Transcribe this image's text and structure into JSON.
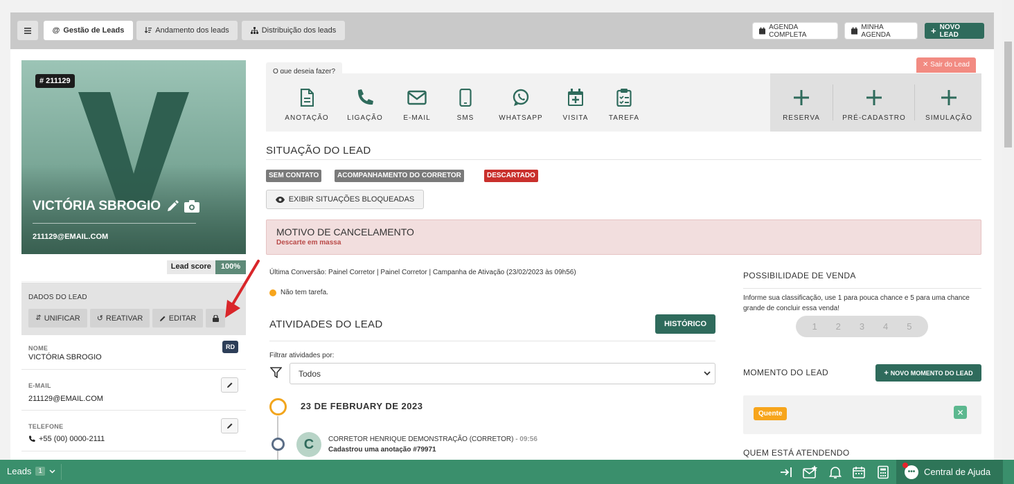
{
  "topbar": {
    "menu_icon": "hamburger-icon",
    "tabs": [
      {
        "label": "Gestão de Leads",
        "icon": "at-icon",
        "active": true
      },
      {
        "label": "Andamento dos leads",
        "icon": "sort-icon",
        "active": false
      },
      {
        "label": "Distribuição dos leads",
        "icon": "sitemap-icon",
        "active": false
      }
    ],
    "agenda_completa": "AGENDA COMPLETA",
    "minha_agenda": "MINHA AGENDA",
    "novo_lead": "NOVO LEAD"
  },
  "lead": {
    "id_badge": "# 211129",
    "avatar_letter": "V",
    "name": "VICTÓRIA SBROGIO",
    "email": "211129@EMAIL.COM",
    "lead_score_label": "Lead score",
    "lead_score_value": "100%",
    "dados_title": "DADOS DO LEAD",
    "buttons": {
      "unificar": "UNIFICAR",
      "reativar": "REATIVAR",
      "editar": "EDITAR"
    },
    "fields": {
      "nome_label": "NOME",
      "nome_value": "VICTÓRIA SBROGIO",
      "rd_badge": "RD",
      "email_label": "E-MAIL",
      "email_value": "211129@EMAIL.COM",
      "telefone_label": "TELEFONE",
      "telefone_value": "+55 (00) 0000-2111"
    }
  },
  "actions": {
    "prompt": "O que deseja fazer?",
    "sair": "Sair do Lead",
    "items": [
      {
        "label": "ANOTAÇÃO",
        "icon": "file-icon"
      },
      {
        "label": "LIGAÇÃO",
        "icon": "phone-icon"
      },
      {
        "label": "E-MAIL",
        "icon": "envelope-icon"
      },
      {
        "label": "SMS",
        "icon": "mobile-icon"
      },
      {
        "label": "WHATSAPP",
        "icon": "whatsapp-icon"
      },
      {
        "label": "VISITA",
        "icon": "calendar-plus-icon"
      },
      {
        "label": "TAREFA",
        "icon": "clipboard-check-icon"
      }
    ],
    "extra": [
      {
        "label": "RESERVA",
        "icon": "plus-icon"
      },
      {
        "label": "PRÉ-CADASTRO",
        "icon": "plus-icon"
      },
      {
        "label": "SIMULAÇÃO",
        "icon": "plus-icon"
      }
    ]
  },
  "situacao": {
    "title": "SITUAÇÃO DO LEAD",
    "tags": [
      {
        "label": "SEM CONTATO",
        "color": "#7a7a7a"
      },
      {
        "label": "ACOMPANHAMENTO DO CORRETOR",
        "color": "#7a7a7a"
      },
      {
        "label": "DESCARTADO",
        "color": "#c9302c"
      }
    ],
    "exibir_bloqueadas": "EXIBIR SITUAÇÕES BLOQUEADAS"
  },
  "cancelamento": {
    "title": "MOTIVO DE CANCELAMENTO",
    "reason": "Descarte em massa"
  },
  "ultima_conversao": "Última Conversão: Painel Corretor | Painel Corretor | Campanha de Ativação (23/02/2023 às 09h56)",
  "tarefa_status": "Não tem tarefa.",
  "atividades": {
    "title": "ATIVIDADES DO LEAD",
    "historico": "HISTÓRICO",
    "filtrar_label": "Filtrar atividades por:",
    "filtro_value": "Todos",
    "date": "23 DE FEBRUARY DE 2023",
    "entry_avatar": "C",
    "entry_author": "CORRETOR HENRIQUE DEMONSTRAÇÃO (CORRETOR)",
    "entry_time": "- 09:56",
    "entry_text": "Cadastrou uma anotação #79971"
  },
  "venda": {
    "title": "POSSIBILIDADE DE VENDA",
    "help": "Informe sua classificação, use 1 para pouca chance e 5 para uma chance grande de concluir essa venda!",
    "ratings": [
      "1",
      "2",
      "3",
      "4",
      "5"
    ]
  },
  "momento": {
    "title": "MOMENTO DO LEAD",
    "novo_button": "NOVO MOMENTO DO LEAD",
    "current": "Quente"
  },
  "quem_atendendo": "QUEM ESTÁ ATENDENDO",
  "bottombar": {
    "leads_label": "Leads",
    "leads_count": "1",
    "help": "Central de Ajuda"
  },
  "colors": {
    "brand": "#2f6b5c",
    "bottom": "#3a8f6c",
    "danger": "#c9302c",
    "warning": "#f7a51c"
  }
}
